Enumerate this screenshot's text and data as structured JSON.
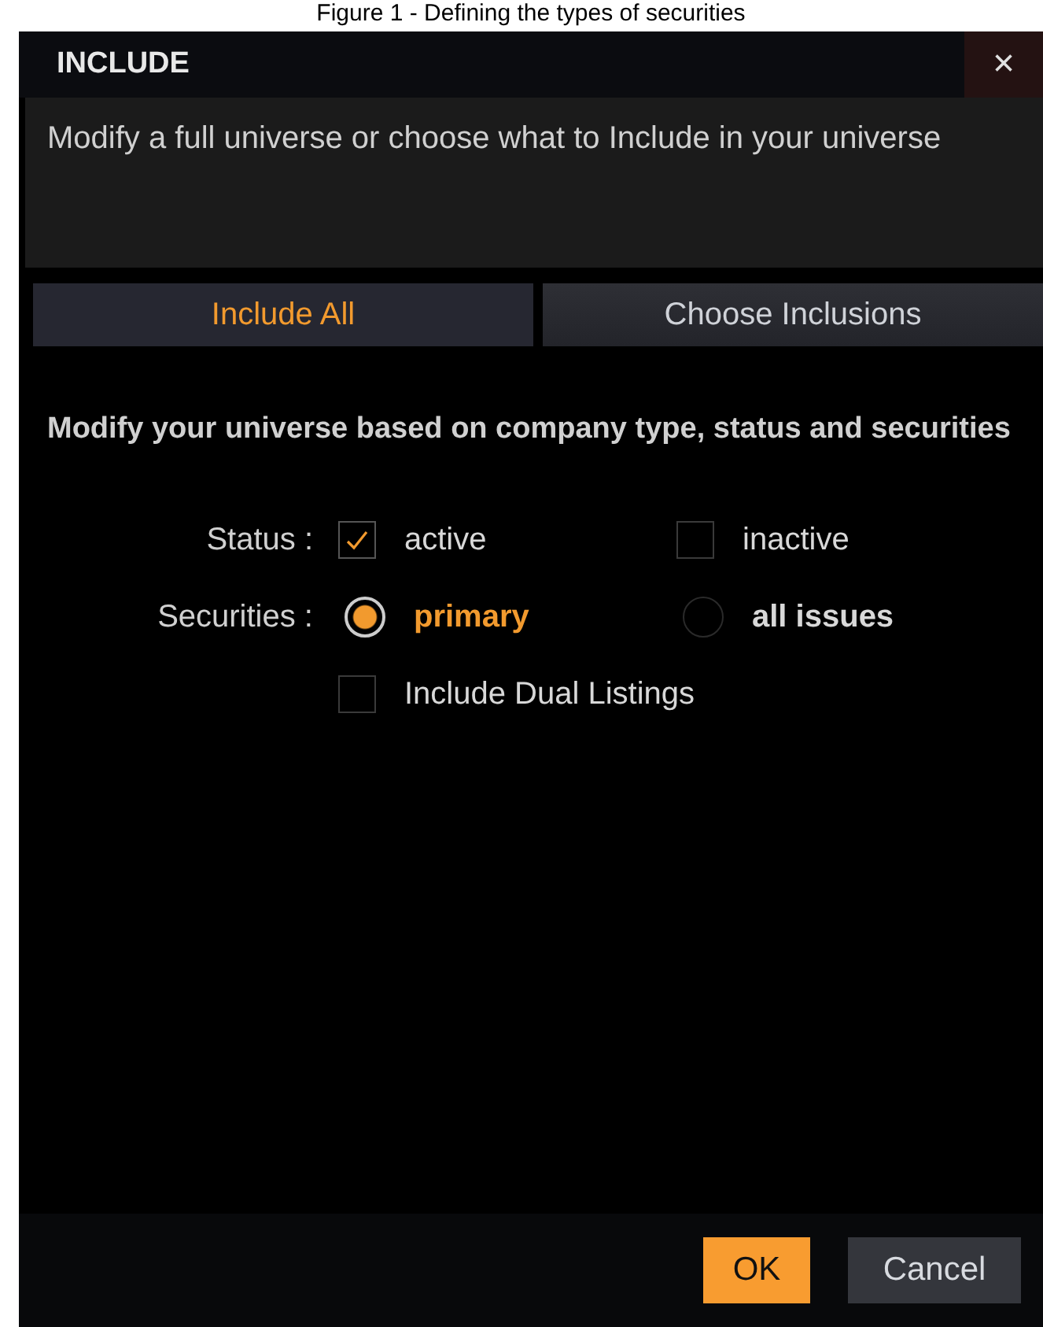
{
  "caption": "Figure 1 - Defining the types of securities",
  "window": {
    "title": "INCLUDE",
    "close": "×"
  },
  "description": "Modify a full universe or choose what to Include in your universe",
  "tabs": [
    {
      "label": "Include All",
      "selected": true
    },
    {
      "label": "Choose Inclusions",
      "selected": false
    }
  ],
  "heading": "Modify your universe based on company type, status and securities",
  "status": {
    "label": "Status :",
    "options": [
      {
        "label": "active",
        "checked": true
      },
      {
        "label": "inactive",
        "checked": false
      }
    ]
  },
  "securities": {
    "label": "Securities :",
    "options": [
      {
        "label": "primary",
        "selected": true
      },
      {
        "label": "all issues",
        "selected": false
      }
    ]
  },
  "dual_listings": {
    "label": "Include Dual Listings",
    "checked": false
  },
  "buttons": [
    {
      "label": "OK",
      "kind": "primary"
    },
    {
      "label": "Cancel",
      "kind": "secondary"
    }
  ]
}
